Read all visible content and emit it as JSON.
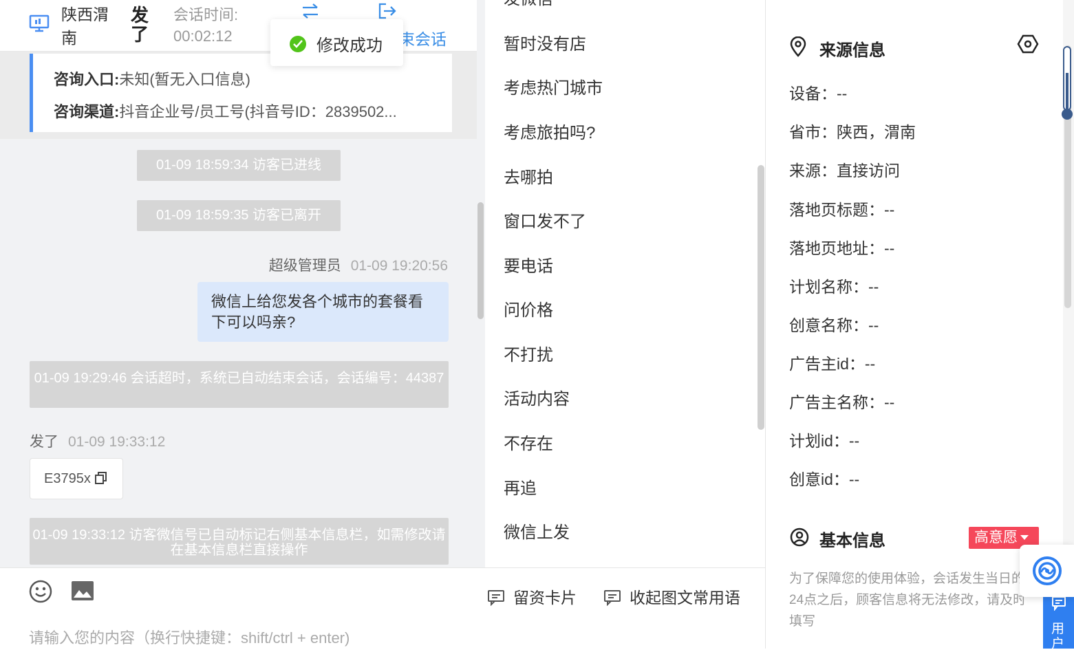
{
  "header": {
    "visitor_name": "陕西渭南",
    "visitor_nick": "发了",
    "session_time_label": "会话时间:",
    "session_time_value": "00:02:12",
    "end_session_label": "束会话",
    "toast_text": "修改成功"
  },
  "consult": {
    "entry_label": "咨询入口:",
    "entry_value": "未知(暂无入口信息)",
    "channel_label": "咨询渠道:",
    "channel_value": "抖音企业号/员工号(抖音号ID：2839502..."
  },
  "messages": {
    "sys1": "01-09 18:59:34 访客已进线",
    "sys2": "01-09 18:59:35 访客已离开",
    "agent_name": "超级管理员",
    "agent_time": "01-09 19:20:56",
    "agent_text": "微信上给您发各个城市的套餐看下可以吗亲?",
    "sys3": "01-09 19:29:46 会话超时，系统已自动结束会话，会话编号：44387",
    "visitor_name": "发了",
    "visitor_time": "01-09 19:33:12",
    "visitor_text": "E3795x",
    "sys4": "01-09 19:33:12 访客微信号已自动标记右侧基本信息栏，如需修改请在基本信息栏直接操作"
  },
  "quick_replies": [
    "发微信",
    "暂时没有店",
    "考虑热门城市",
    "考虑旅拍吗?",
    "去哪拍",
    "窗口发不了",
    "要电话",
    "问价格",
    "不打扰",
    "活动内容",
    "不存在",
    "再追",
    "微信上发"
  ],
  "input": {
    "card_label": "留资卡片",
    "collapse_label": "收起图文常用语",
    "placeholder": "请输入您的内容（换行快捷键：shift/ctrl + enter)"
  },
  "source_info": {
    "title": "来源信息",
    "rows": [
      "设备：--",
      "省市：陕西，渭南",
      "来源：直接访问",
      "落地页标题：--",
      "落地页地址：--",
      "计划名称：--",
      "创意名称：--",
      "广告主id：--",
      "广告主名称：--",
      "计划id：--",
      "创意id：--"
    ]
  },
  "basic_info": {
    "title": "基本信息",
    "intent_badge": "高意愿",
    "notice": "为了保障您的使用体验，会话发生当日的24点之后，顾客信息将无法修改，请及时填写"
  },
  "side_tab_label": "用户",
  "colors": {
    "accent": "#3a8ee6",
    "badge": "#f5475a",
    "bubble_out": "#dbe8fb",
    "success": "#52c41a"
  }
}
